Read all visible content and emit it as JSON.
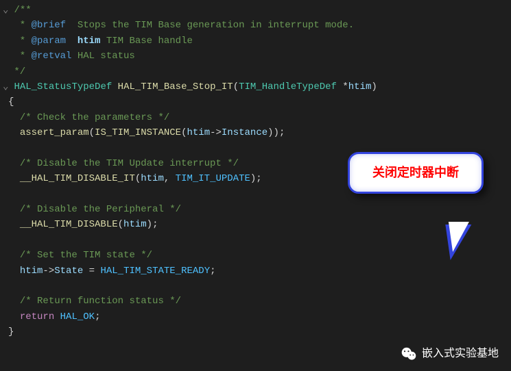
{
  "doc": {
    "open": "/**",
    "brief_tag": "@brief",
    "brief_text": "  Stops the TIM Base generation in interrupt mode.",
    "param_tag": "@param",
    "param_name": "htim",
    "param_text": " TIM Base handle",
    "retval_tag": "@retval",
    "retval_text": " HAL status",
    "close": " */",
    "star": "  * "
  },
  "sig": {
    "return_type": "HAL_StatusTypeDef",
    "func_name": "HAL_TIM_Base_Stop_IT",
    "param_type": "TIM_HandleTypeDef",
    "param_star": " *",
    "param_name": "htim"
  },
  "braces": {
    "open": "{",
    "close": "}"
  },
  "body": {
    "c1": "/* Check the parameters */",
    "assert_fn": "assert_param",
    "is_instance": "IS_TIM_INSTANCE",
    "htim": "htim",
    "arrow": "->",
    "instance": "Instance",
    "c2": "/* Disable the TIM Update interrupt */",
    "disable_it": "__HAL_TIM_DISABLE_IT",
    "tim_it_update": "TIM_IT_UPDATE",
    "c3": "/* Disable the Peripheral */",
    "disable": "__HAL_TIM_DISABLE",
    "c4": "/* Set the TIM state */",
    "state": "State",
    "state_ready": "HAL_TIM_STATE_READY",
    "c5": "/* Return function status */",
    "return_kw": "return",
    "hal_ok": "HAL_OK"
  },
  "punct": {
    "lparen": "(",
    "rparen": ")",
    "semi": ";",
    "comma": ", ",
    "assign": " = "
  },
  "callout": {
    "text": "关闭定时器中断"
  },
  "watermark": {
    "text": "嵌入式实验基地",
    "icon": "wechat-icon"
  }
}
